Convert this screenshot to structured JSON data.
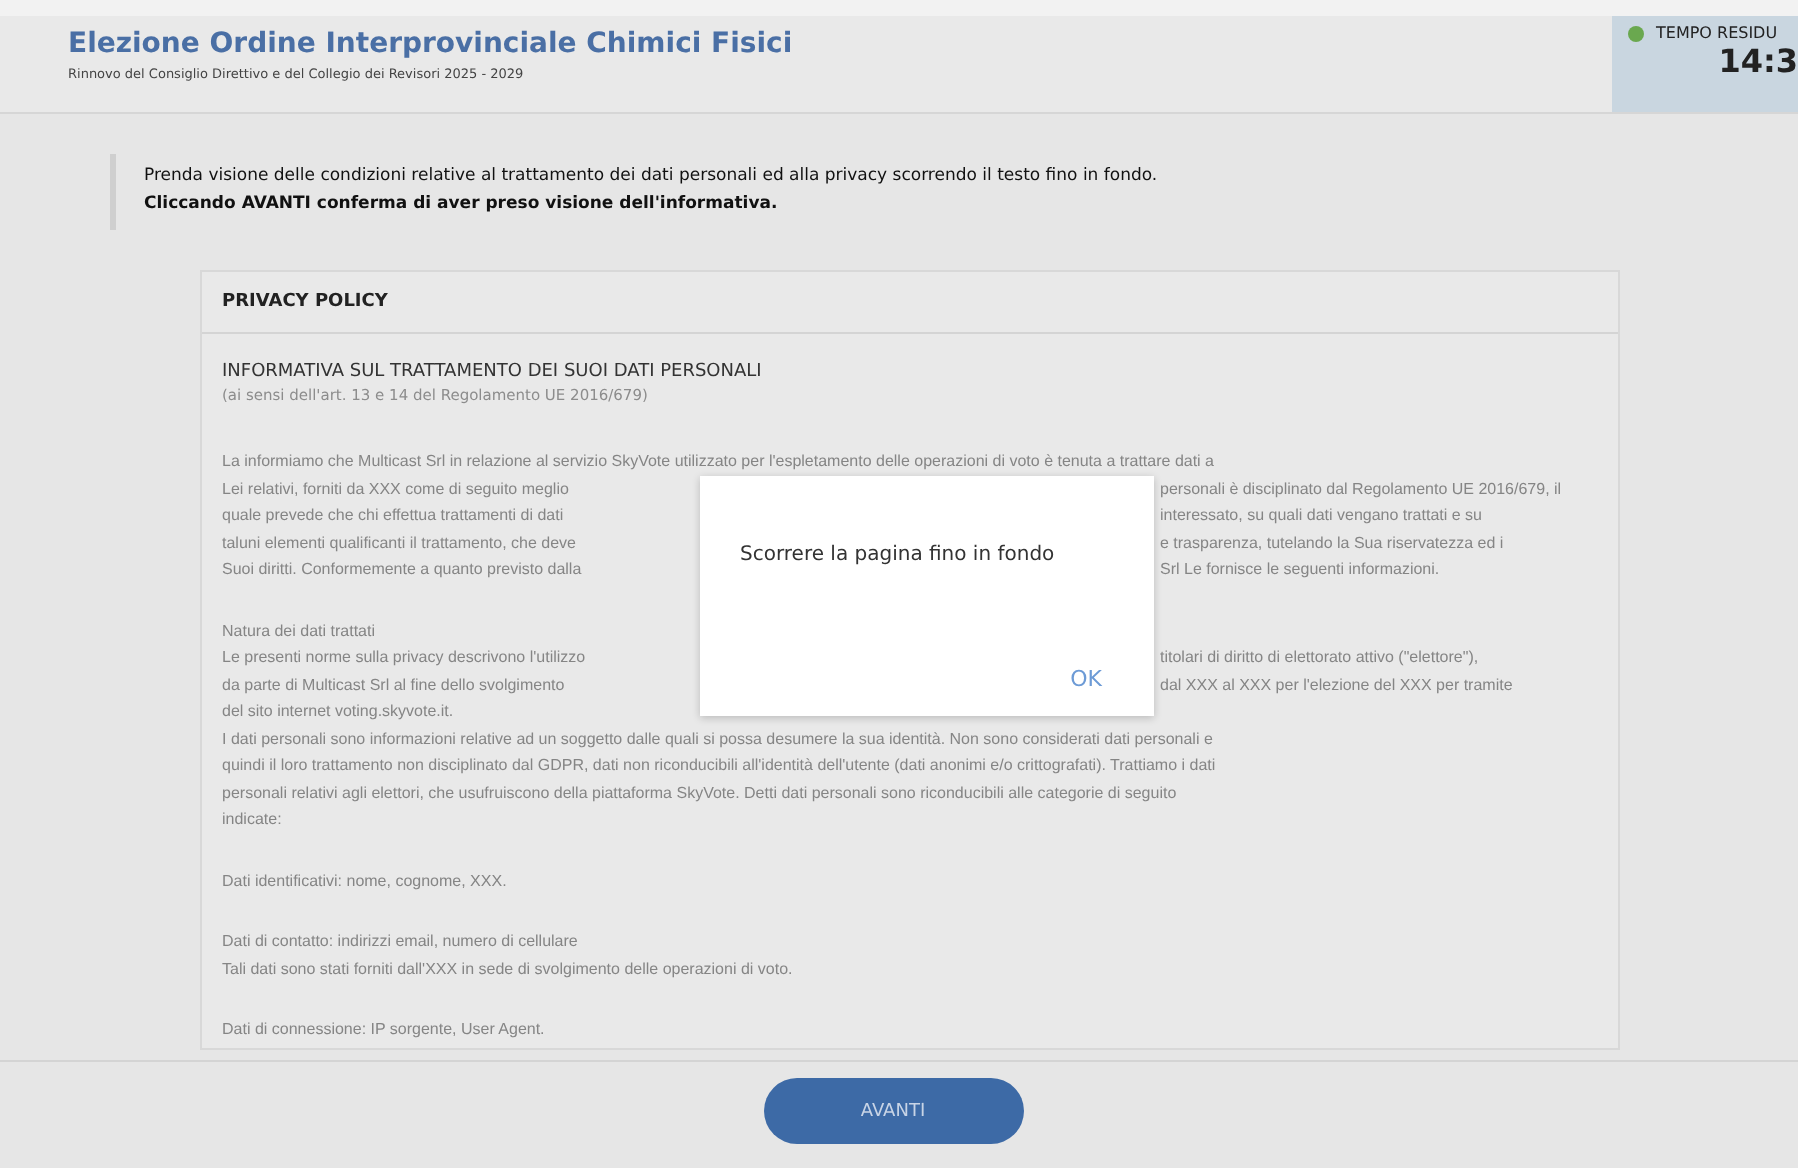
{
  "header": {
    "title": "Elezione Ordine Interprovinciale Chimici Fisici",
    "subtitle": "Rinnovo del Consiglio Direttivo e del Collegio dei Revisori 2025 - 2029"
  },
  "timer": {
    "label": "TEMPO RESIDU",
    "value": "14:3",
    "color": "#6aa84f"
  },
  "notice": [
    "Prenda visione delle condizioni relative al trattamento dei dati personali ed alla privacy scorrendo il testo fino in fondo.",
    "Cliccando AVANTI conferma di aver preso visione dell'informativa."
  ],
  "policy": {
    "title": "PRIVACY POLICY",
    "heading": "INFORMATIVA SUL TRATTAMENTO DEI SUOI DATI PERSONALI",
    "subheading": "(ai sensi dell'art. 13 e 14 del Regolamento UE 2016/679)",
    "blocks": [
      {
        "lines": [
          {
            "kind": "full",
            "text": "La informiamo che Multicast Srl in relazione al servizio SkyVote utilizzato per l'espletamento delle operazioni di voto è tenuta a trattare dati a"
          },
          {
            "kind": "split",
            "left": "Lei relativi, forniti da XXX come di seguito meglio",
            "right": "personali è disciplinato dal Regolamento UE 2016/679, il"
          },
          {
            "kind": "split",
            "left": "quale prevede che chi effettua trattamenti di dati",
            "right": "interessato, su quali dati vengano trattati e su"
          },
          {
            "kind": "split",
            "left": "taluni elementi qualificanti il trattamento, che deve",
            "right": "e trasparenza, tutelando la Sua riservatezza ed i"
          },
          {
            "kind": "split",
            "left": "Suoi diritti. Conformemente a quanto previsto dalla",
            "right": "Srl Le fornisce le seguenti informazioni."
          }
        ]
      },
      {
        "lines": [
          {
            "kind": "full",
            "text": "Natura dei dati trattati"
          },
          {
            "kind": "split",
            "left": "Le presenti norme sulla privacy descrivono l'utilizzo",
            "right": "titolari di diritto di elettorato attivo (\"elettore\"),"
          },
          {
            "kind": "split",
            "left": "da parte di Multicast Srl al fine dello svolgimento",
            "right": "dal XXX al XXX per l'elezione del XXX per tramite"
          },
          {
            "kind": "full",
            "text": "del sito internet voting.skyvote.it."
          },
          {
            "kind": "full",
            "text": "I dati personali sono informazioni relative ad un soggetto dalle quali si possa desumere la sua identità. Non sono considerati dati personali e"
          },
          {
            "kind": "full",
            "text": "quindi il loro trattamento non disciplinato dal GDPR, dati non riconducibili all'identità dell'utente (dati anonimi e/o crittografati). Trattiamo i dati"
          },
          {
            "kind": "full",
            "text": "personali relativi agli elettori, che usufruiscono della piattaforma SkyVote. Detti dati personali sono riconducibili alle categorie di seguito"
          },
          {
            "kind": "full",
            "text": "indicate:"
          }
        ]
      },
      {
        "lines": [
          {
            "kind": "full",
            "text": "Dati identificativi: nome, cognome, XXX."
          }
        ]
      },
      {
        "lines": [
          {
            "kind": "full",
            "text": "Dati di contatto: indirizzi email, numero di cellulare"
          },
          {
            "kind": "full",
            "text": "Tali dati sono stati forniti dall'XXX in sede di svolgimento delle operazioni di voto."
          }
        ]
      },
      {
        "lines": [
          {
            "kind": "full",
            "text": "Dati di connessione: IP sorgente, User Agent."
          }
        ]
      }
    ]
  },
  "dialog": {
    "message": "Scorrere la pagina fino in fondo",
    "button": "OK"
  },
  "footer": {
    "button": "AVANTI"
  }
}
